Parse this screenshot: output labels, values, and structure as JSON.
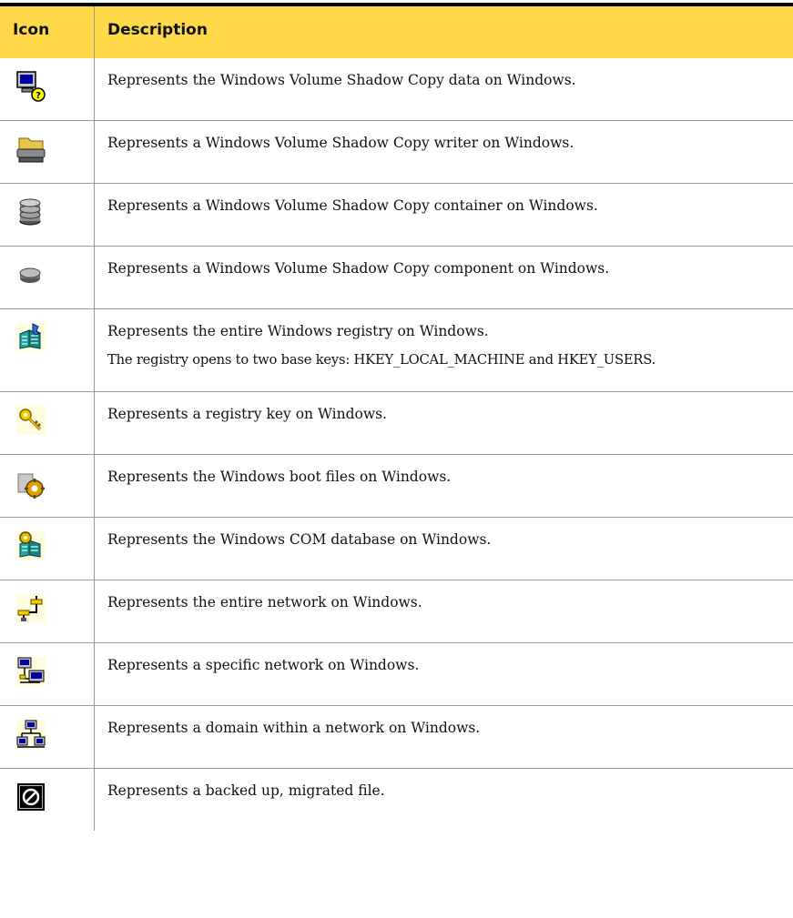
{
  "table": {
    "headers": {
      "icon": "Icon",
      "description": "Description"
    },
    "rows": [
      {
        "icon": "vss-data-icon",
        "lines": [
          "Represents the Windows Volume Shadow Copy data on Windows."
        ]
      },
      {
        "icon": "vss-writer-icon",
        "lines": [
          "Represents a Windows Volume Shadow Copy writer on Windows."
        ]
      },
      {
        "icon": "vss-container-icon",
        "lines": [
          "Represents a Windows Volume Shadow Copy container on Windows."
        ]
      },
      {
        "icon": "vss-component-icon",
        "lines": [
          "Represents a Windows Volume Shadow Copy component on Windows."
        ]
      },
      {
        "icon": "registry-icon",
        "lines": [
          "Represents the entire Windows registry on Windows.",
          "The registry opens to two base keys: HKEY_LOCAL_MACHINE and HKEY_USERS."
        ]
      },
      {
        "icon": "registry-key-icon",
        "lines": [
          "Represents a registry key on Windows."
        ]
      },
      {
        "icon": "boot-files-icon",
        "lines": [
          "Represents the Windows boot files on Windows."
        ]
      },
      {
        "icon": "com-database-icon",
        "lines": [
          "Represents the Windows COM database on Windows."
        ]
      },
      {
        "icon": "entire-network-icon",
        "lines": [
          "Represents the entire network on Windows."
        ]
      },
      {
        "icon": "specific-network-icon",
        "lines": [
          "Represents a specific network on Windows."
        ]
      },
      {
        "icon": "domain-icon",
        "lines": [
          "Represents a domain within a network on Windows."
        ]
      },
      {
        "icon": "migrated-file-icon",
        "lines": [
          "Represents a backed up, migrated file."
        ]
      }
    ]
  }
}
